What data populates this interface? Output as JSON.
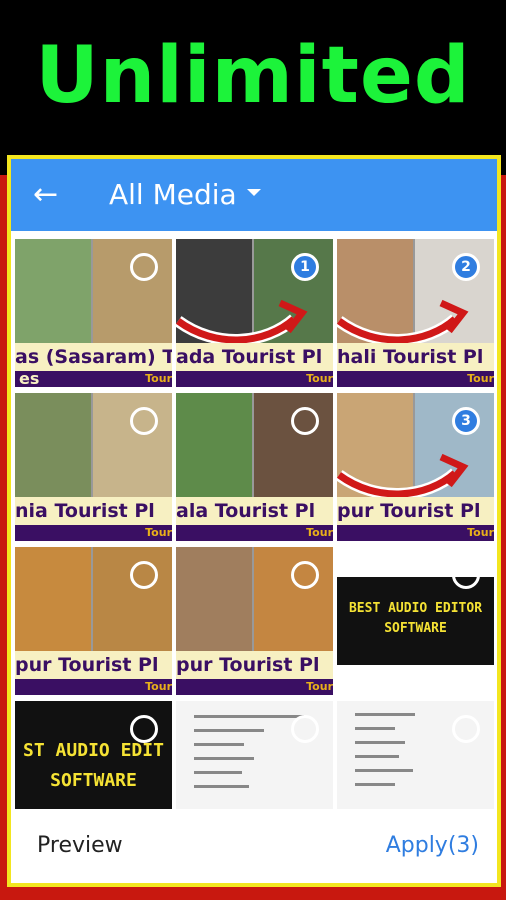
{
  "banner": {
    "headline": "Unlimited"
  },
  "appbar": {
    "back_icon": "arrow-left-icon",
    "title": "All Media",
    "dropdown_icon": "caret-down-icon"
  },
  "tiles": [
    {
      "caption": "as (Sasaram) To",
      "sub": "es",
      "tour": "Tour",
      "selected": false,
      "colorL": "#7fa36a",
      "colorR": "#b79b6b"
    },
    {
      "caption": "ada Tourist Pl",
      "tour": "Tour",
      "selected": true,
      "order": "1",
      "colorL": "#3c3c3c",
      "colorR": "#56784a"
    },
    {
      "caption": "hali Tourist Pl",
      "tour": "Tour",
      "selected": true,
      "order": "2",
      "colorL": "#b98f69",
      "colorR": "#d9d5cf"
    },
    {
      "caption": "nia Tourist Pl",
      "tour": "Tour",
      "selected": false,
      "colorL": "#7a8e5c",
      "colorR": "#c7b48b"
    },
    {
      "caption": "ala Tourist Pl",
      "tour": "Tour",
      "selected": false,
      "colorL": "#5e8b4a",
      "colorR": "#6b5240"
    },
    {
      "caption": "pur Tourist Pl",
      "tour": "Tour",
      "selected": true,
      "order": "3",
      "colorL": "#c9a575",
      "colorR": "#9fb8c8"
    },
    {
      "caption": "pur Tourist Pl",
      "tour": "Tour",
      "selected": false,
      "colorL": "#c78a3e",
      "colorR": "#b98745"
    },
    {
      "caption": "pur Tourist Pl",
      "tour": "Tour",
      "selected": false,
      "colorL": "#a07e5e",
      "colorR": "#c48641"
    }
  ],
  "audio_tiles": [
    {
      "line1": "BEST AUDIO EDITOR",
      "line2": "SOFTWARE"
    },
    {
      "line1": "ST AUDIO EDIT",
      "line2": "SOFTWARE"
    }
  ],
  "bottom": {
    "preview_label": "Preview",
    "apply_label": "Apply(3)"
  },
  "colors": {
    "appbar": "#3d93f2",
    "accent": "#2f7de0",
    "headline": "#1cf33a",
    "frame": "#f3e61f",
    "background": "#c8180f"
  }
}
